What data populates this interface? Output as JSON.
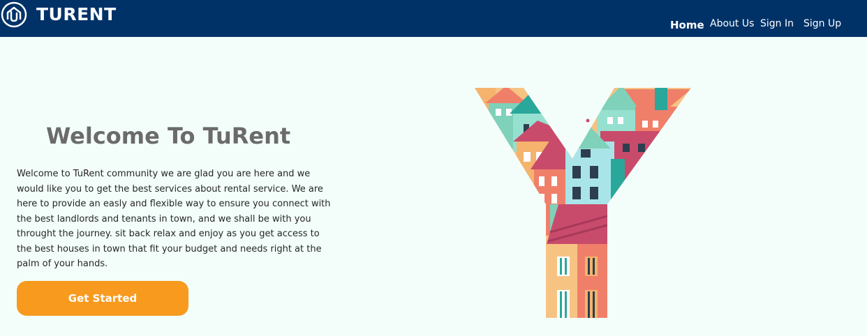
{
  "navbar": {
    "brand": "TURENT",
    "links": {
      "home": "Home",
      "about": "About Us",
      "sign_in": "Sign In",
      "sign_up": "Sign Up"
    }
  },
  "hero": {
    "title": "Welcome To TuRent",
    "body": "Welcome to TuRent community we are glad you are here and we would like you to get the best services about rental service. We are here to provide an easly and flexible way to ensure you connect with the best landlords and tenants in town, and we shall be with you throught the journey. sit back relax and enjoy as you get access to the best houses in town that fit your budget and needs right at the palm of your hands.",
    "cta_label": "Get Started"
  },
  "colors": {
    "navbar": "#003268",
    "page_bg": "#f3fefb",
    "cta": "#f79a1e",
    "title": "#6b6b6b"
  }
}
